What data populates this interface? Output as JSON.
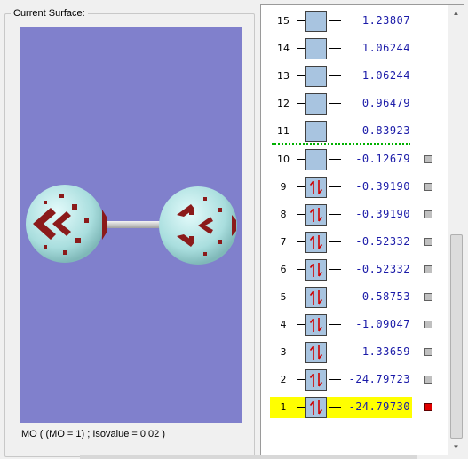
{
  "surface_panel": {
    "caption": "Current Surface:",
    "status": "MO ( (MO = 1) ; Isovalue = 0.02 )"
  },
  "orbital_levels": [
    {
      "number": "15",
      "energy": "1.23807",
      "occupied": false,
      "checkbox": false,
      "selected": false
    },
    {
      "number": "14",
      "energy": "1.06244",
      "occupied": false,
      "checkbox": false,
      "selected": false
    },
    {
      "number": "13",
      "energy": "1.06244",
      "occupied": false,
      "checkbox": false,
      "selected": false
    },
    {
      "number": "12",
      "energy": "0.96479",
      "occupied": false,
      "checkbox": false,
      "selected": false
    },
    {
      "number": "11",
      "energy": "0.83923",
      "occupied": false,
      "checkbox": false,
      "selected": false
    },
    {
      "number": "10",
      "energy": "-0.12679",
      "occupied": false,
      "checkbox": true,
      "selected": false
    },
    {
      "number": "9",
      "energy": "-0.39190",
      "occupied": true,
      "checkbox": true,
      "selected": false
    },
    {
      "number": "8",
      "energy": "-0.39190",
      "occupied": true,
      "checkbox": true,
      "selected": false
    },
    {
      "number": "7",
      "energy": "-0.52332",
      "occupied": true,
      "checkbox": true,
      "selected": false
    },
    {
      "number": "6",
      "energy": "-0.52332",
      "occupied": true,
      "checkbox": true,
      "selected": false
    },
    {
      "number": "5",
      "energy": "-0.58753",
      "occupied": true,
      "checkbox": true,
      "selected": false
    },
    {
      "number": "4",
      "energy": "-1.09047",
      "occupied": true,
      "checkbox": true,
      "selected": false
    },
    {
      "number": "3",
      "energy": "-1.33659",
      "occupied": true,
      "checkbox": true,
      "selected": false
    },
    {
      "number": "2",
      "energy": "-24.79723",
      "occupied": true,
      "checkbox": true,
      "selected": false
    },
    {
      "number": "1",
      "energy": "-24.79730",
      "occupied": true,
      "checkbox": true,
      "selected": true
    }
  ],
  "colors": {
    "viewport_bg": "#8080cc",
    "atom": "#b8e8e8",
    "lobe": "#8b1a1a",
    "highlight": "#ffff00",
    "energy_text": "#1a1aa8",
    "homo_lumo_divider": "#00b000",
    "selected_marker": "#e00000"
  }
}
